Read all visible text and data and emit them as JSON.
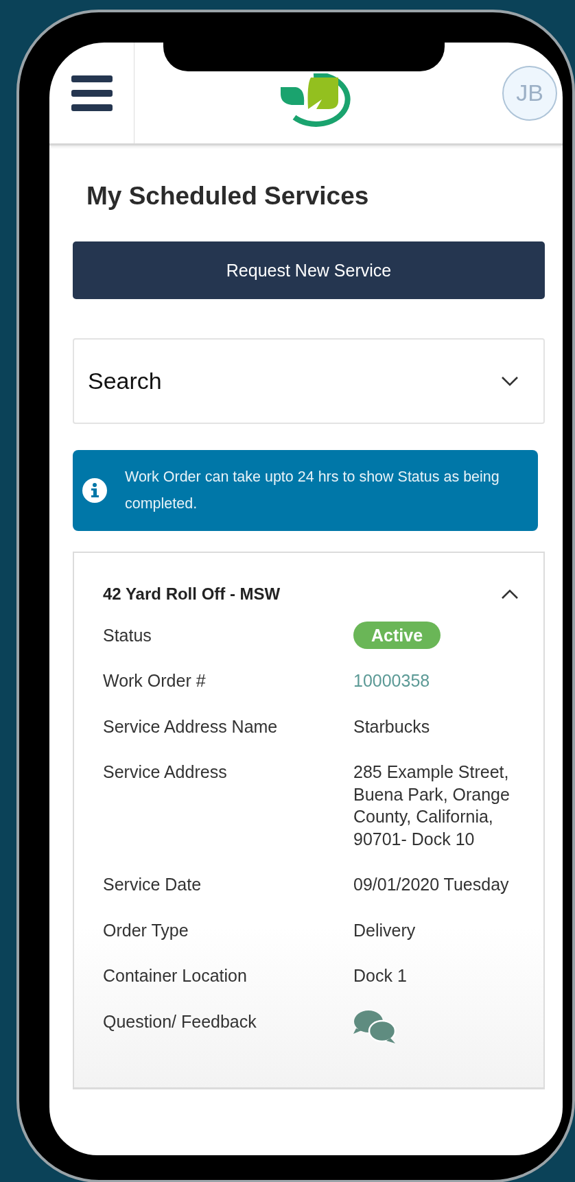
{
  "header": {
    "avatar_initials": "JB"
  },
  "title": "My Scheduled Services",
  "request_button": "Request New Service",
  "search": {
    "label": "Search",
    "expanded": false
  },
  "alert": {
    "text": "Work Order can take upto 24 hrs to show Status as being completed."
  },
  "service": {
    "title": "42 Yard Roll Off - MSW",
    "expanded": true,
    "fields": [
      {
        "label": "Status",
        "kind": "badge",
        "value": "Active",
        "color": "#6ab657"
      },
      {
        "label": "Work Order #",
        "kind": "link",
        "value": "10000358"
      },
      {
        "label": "Service Address Name",
        "kind": "text",
        "value": "Starbucks"
      },
      {
        "label": "Service Address",
        "kind": "text",
        "value": "285 Example Street, Buena Park, Orange County, California, 90701- Dock 10"
      },
      {
        "label": "Service Date",
        "kind": "text",
        "value": "09/01/2020 Tuesday"
      },
      {
        "label": "Order Type",
        "kind": "text",
        "value": "Delivery"
      },
      {
        "label": "Container Location",
        "kind": "text",
        "value": "Dock 1"
      },
      {
        "label": "Question/ Feedback",
        "kind": "chat"
      }
    ]
  }
}
